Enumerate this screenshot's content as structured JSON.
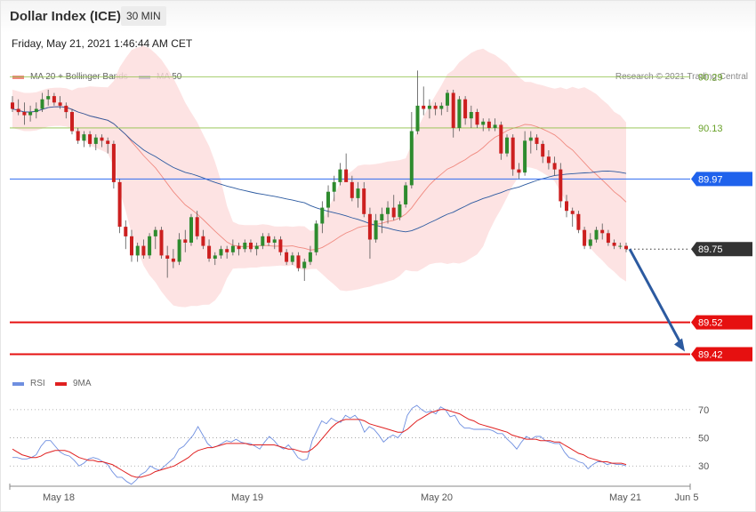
{
  "header": {
    "title": "Dollar Index (ICE)",
    "timeframe": "30 MIN",
    "datetime": "Friday, May 21, 2021 1:46:44 AM CET"
  },
  "legend_main": [
    {
      "label": "MA 20 + Bollinger Bands",
      "color": "#f08a80"
    },
    {
      "label": "MA 50",
      "color": "#2c5aa0"
    }
  ],
  "copyright": "Research © 2021 Trading Central",
  "legend_rsi": [
    {
      "label": "RSI",
      "color": "#6f8fe0"
    },
    {
      "label": "9MA",
      "color": "#e02020"
    }
  ],
  "chart_data": [
    {
      "type": "candlestick",
      "y_range": [
        89.36,
        90.42
      ],
      "x_labels": [
        "May 18",
        "May 19",
        "May 20",
        "May 21",
        "Jun 5"
      ],
      "levels": [
        {
          "value": 90.29,
          "label": "90.29",
          "color": "#8dbf45",
          "style": "solid-thin",
          "text_color": "#6aa22a"
        },
        {
          "value": 90.13,
          "label": "90.13",
          "color": "#8dbf45",
          "style": "solid-thin",
          "text_color": "#6aa22a"
        },
        {
          "value": 89.97,
          "label": "89.97",
          "color": "#2f6bf0",
          "style": "solid",
          "badge": "#1f62ec"
        },
        {
          "value": 89.75,
          "label": "89.75",
          "color": "#333333",
          "style": "dotted",
          "badge": "#333333"
        },
        {
          "value": 89.52,
          "label": "89.52",
          "color": "#e61010",
          "style": "solid-thick",
          "badge": "#e61010"
        },
        {
          "value": 89.42,
          "label": "89.42",
          "color": "#e61010",
          "style": "solid-thick",
          "badge": "#e61010"
        }
      ],
      "forecast_arrow": {
        "from": 89.75,
        "to": 89.42,
        "color": "#2c5aa0"
      },
      "candles": [
        [
          90.21,
          90.23,
          90.18,
          90.19
        ],
        [
          90.19,
          90.22,
          90.17,
          90.18
        ],
        [
          90.18,
          90.21,
          90.14,
          90.17
        ],
        [
          90.17,
          90.2,
          90.15,
          90.18
        ],
        [
          90.18,
          90.21,
          90.16,
          90.19
        ],
        [
          90.19,
          90.24,
          90.18,
          90.22
        ],
        [
          90.22,
          90.25,
          90.2,
          90.23
        ],
        [
          90.23,
          90.24,
          90.2,
          90.21
        ],
        [
          90.21,
          90.23,
          90.19,
          90.2
        ],
        [
          90.2,
          90.21,
          90.16,
          90.18
        ],
        [
          90.18,
          90.19,
          90.11,
          90.12
        ],
        [
          90.12,
          90.13,
          90.08,
          90.09
        ],
        [
          90.09,
          90.12,
          90.07,
          90.11
        ],
        [
          90.11,
          90.12,
          90.07,
          90.08
        ],
        [
          90.08,
          90.11,
          90.06,
          90.1
        ],
        [
          90.1,
          90.11,
          90.07,
          90.09
        ],
        [
          90.09,
          90.1,
          90.05,
          90.08
        ],
        [
          90.08,
          90.09,
          89.94,
          89.96
        ],
        [
          89.96,
          89.97,
          89.8,
          89.82
        ],
        [
          89.82,
          89.84,
          89.75,
          89.79
        ],
        [
          89.79,
          89.81,
          89.71,
          89.73
        ],
        [
          89.73,
          89.77,
          89.71,
          89.76
        ],
        [
          89.76,
          89.78,
          89.72,
          89.73
        ],
        [
          89.73,
          89.8,
          89.72,
          89.79
        ],
        [
          89.79,
          89.82,
          89.75,
          89.81
        ],
        [
          89.81,
          89.82,
          89.72,
          89.73
        ],
        [
          89.73,
          89.76,
          89.66,
          89.72
        ],
        [
          89.72,
          89.75,
          89.69,
          89.71
        ],
        [
          89.71,
          89.8,
          89.7,
          89.78
        ],
        [
          89.78,
          89.81,
          89.74,
          89.77
        ],
        [
          89.77,
          89.86,
          89.76,
          89.85
        ],
        [
          89.85,
          89.87,
          89.78,
          89.79
        ],
        [
          89.79,
          89.81,
          89.75,
          89.76
        ],
        [
          89.76,
          89.78,
          89.71,
          89.72
        ],
        [
          89.72,
          89.74,
          89.7,
          89.73
        ],
        [
          89.73,
          89.76,
          89.72,
          89.75
        ],
        [
          89.75,
          89.76,
          89.72,
          89.74
        ],
        [
          89.74,
          89.78,
          89.73,
          89.76
        ],
        [
          89.76,
          89.77,
          89.73,
          89.75
        ],
        [
          89.75,
          89.78,
          89.74,
          89.77
        ],
        [
          89.77,
          89.78,
          89.74,
          89.75
        ],
        [
          89.75,
          89.77,
          89.73,
          89.76
        ],
        [
          89.76,
          89.8,
          89.75,
          89.79
        ],
        [
          89.79,
          89.8,
          89.76,
          89.77
        ],
        [
          89.77,
          89.79,
          89.75,
          89.78
        ],
        [
          89.78,
          89.79,
          89.73,
          89.74
        ],
        [
          89.74,
          89.75,
          89.7,
          89.71
        ],
        [
          89.71,
          89.74,
          89.7,
          89.73
        ],
        [
          89.73,
          89.74,
          89.68,
          89.69
        ],
        [
          89.69,
          89.72,
          89.65,
          89.71
        ],
        [
          89.71,
          89.76,
          89.7,
          89.74
        ],
        [
          89.74,
          89.84,
          89.73,
          89.83
        ],
        [
          89.83,
          89.9,
          89.8,
          89.88
        ],
        [
          89.88,
          89.95,
          89.85,
          89.93
        ],
        [
          89.93,
          89.98,
          89.9,
          89.96
        ],
        [
          89.96,
          90.02,
          89.95,
          90.0
        ],
        [
          90.0,
          90.05,
          89.98,
          89.96
        ],
        [
          89.96,
          89.98,
          89.9,
          89.91
        ],
        [
          89.91,
          89.96,
          89.88,
          89.94
        ],
        [
          89.94,
          89.96,
          89.85,
          89.86
        ],
        [
          89.86,
          89.88,
          89.72,
          89.78
        ],
        [
          89.78,
          89.86,
          89.77,
          89.84
        ],
        [
          89.84,
          89.88,
          89.8,
          89.86
        ],
        [
          89.86,
          89.9,
          89.83,
          89.88
        ],
        [
          89.88,
          89.92,
          89.84,
          89.85
        ],
        [
          89.85,
          89.9,
          89.84,
          89.89
        ],
        [
          89.89,
          89.96,
          89.88,
          89.95
        ],
        [
          89.95,
          90.18,
          89.94,
          90.12
        ],
        [
          90.12,
          90.31,
          90.11,
          90.2
        ],
        [
          90.2,
          90.26,
          90.17,
          90.19
        ],
        [
          90.19,
          90.22,
          90.16,
          90.2
        ],
        [
          90.2,
          90.21,
          90.17,
          90.19
        ],
        [
          90.19,
          90.21,
          90.17,
          90.2
        ],
        [
          90.2,
          90.25,
          90.18,
          90.24
        ],
        [
          90.24,
          90.25,
          90.1,
          90.13
        ],
        [
          90.13,
          90.23,
          90.12,
          90.22
        ],
        [
          90.22,
          90.23,
          90.14,
          90.16
        ],
        [
          90.16,
          90.2,
          90.13,
          90.18
        ],
        [
          90.18,
          90.19,
          90.13,
          90.14
        ],
        [
          90.14,
          90.16,
          90.12,
          90.15
        ],
        [
          90.15,
          90.16,
          90.12,
          90.13
        ],
        [
          90.13,
          90.16,
          90.12,
          90.14
        ],
        [
          90.14,
          90.15,
          90.03,
          90.05
        ],
        [
          90.05,
          90.11,
          90.04,
          90.1
        ],
        [
          90.1,
          90.11,
          89.98,
          90.0
        ],
        [
          90.0,
          90.02,
          89.97,
          89.99
        ],
        [
          89.99,
          90.12,
          89.98,
          90.09
        ],
        [
          90.09,
          90.12,
          90.05,
          90.1
        ],
        [
          90.1,
          90.11,
          90.06,
          90.08
        ],
        [
          90.08,
          90.09,
          90.02,
          90.04
        ],
        [
          90.04,
          90.06,
          90.0,
          90.02
        ],
        [
          90.02,
          90.04,
          89.98,
          90.0
        ],
        [
          90.0,
          90.02,
          89.88,
          89.9
        ],
        [
          89.9,
          89.92,
          89.85,
          89.87
        ],
        [
          89.87,
          89.88,
          89.82,
          89.86
        ],
        [
          89.86,
          89.87,
          89.8,
          89.81
        ],
        [
          89.81,
          89.82,
          89.75,
          89.76
        ],
        [
          89.76,
          89.8,
          89.75,
          89.78
        ],
        [
          89.78,
          89.82,
          89.77,
          89.81
        ],
        [
          89.81,
          89.83,
          89.78,
          89.8
        ],
        [
          89.8,
          89.81,
          89.76,
          89.77
        ],
        [
          89.77,
          89.78,
          89.75,
          89.76
        ],
        [
          89.76,
          89.77,
          89.75,
          89.76
        ],
        [
          89.76,
          89.77,
          89.74,
          89.75
        ]
      ]
    },
    {
      "type": "line",
      "name": "RSI",
      "y_ticks": [
        70,
        50,
        30
      ],
      "y_range": [
        15,
        80
      ],
      "series": [
        {
          "name": "RSI",
          "color": "#6f8fe0",
          "values": [
            36,
            36,
            35,
            35,
            36,
            38,
            44,
            48,
            48,
            44,
            40,
            38,
            37,
            34,
            30,
            32,
            35,
            36,
            35,
            33,
            31,
            26,
            22,
            22,
            19,
            17,
            20,
            24,
            26,
            30,
            28,
            27,
            30,
            33,
            36,
            42,
            44,
            48,
            52,
            58,
            52,
            46,
            43,
            44,
            46,
            48,
            47,
            49,
            47,
            46,
            46,
            44,
            42,
            47,
            51,
            48,
            44,
            42,
            45,
            41,
            36,
            34,
            35,
            48,
            55,
            62,
            60,
            64,
            62,
            61,
            66,
            64,
            66,
            62,
            54,
            58,
            56,
            52,
            47,
            50,
            52,
            50,
            54,
            66,
            71,
            73,
            70,
            68,
            69,
            67,
            72,
            70,
            65,
            66,
            60,
            57,
            57,
            56,
            56,
            56,
            56,
            55,
            53,
            53,
            49,
            46,
            42,
            47,
            51,
            49,
            51,
            51,
            48,
            47,
            46,
            46,
            40,
            36,
            35,
            33,
            32,
            28,
            31,
            33,
            33,
            31,
            32,
            31,
            31,
            30
          ]
        },
        {
          "name": "9MA",
          "color": "#e02020",
          "values": [
            42,
            40,
            38,
            37,
            36,
            36,
            37,
            39,
            40,
            41,
            41,
            41,
            40,
            38,
            36,
            35,
            34,
            34,
            33,
            33,
            32,
            31,
            29,
            27,
            25,
            23,
            22,
            22,
            23,
            24,
            26,
            27,
            28,
            29,
            30,
            32,
            34,
            36,
            39,
            41,
            42,
            43,
            43,
            44,
            45,
            46,
            46,
            46,
            46,
            46,
            45,
            45,
            45,
            45,
            45,
            45,
            44,
            43,
            42,
            42,
            41,
            40,
            40,
            42,
            45,
            49,
            53,
            57,
            60,
            62,
            63,
            63,
            63,
            63,
            62,
            60,
            59,
            58,
            57,
            56,
            55,
            54,
            54,
            56,
            59,
            62,
            64,
            66,
            68,
            69,
            70,
            70,
            69,
            68,
            67,
            65,
            63,
            62,
            60,
            59,
            58,
            57,
            56,
            55,
            54,
            52,
            51,
            50,
            49,
            49,
            49,
            48,
            48,
            48,
            47,
            47,
            45,
            43,
            41,
            39,
            38,
            36,
            35,
            34,
            33,
            33,
            32,
            32,
            32,
            31
          ]
        }
      ]
    }
  ]
}
